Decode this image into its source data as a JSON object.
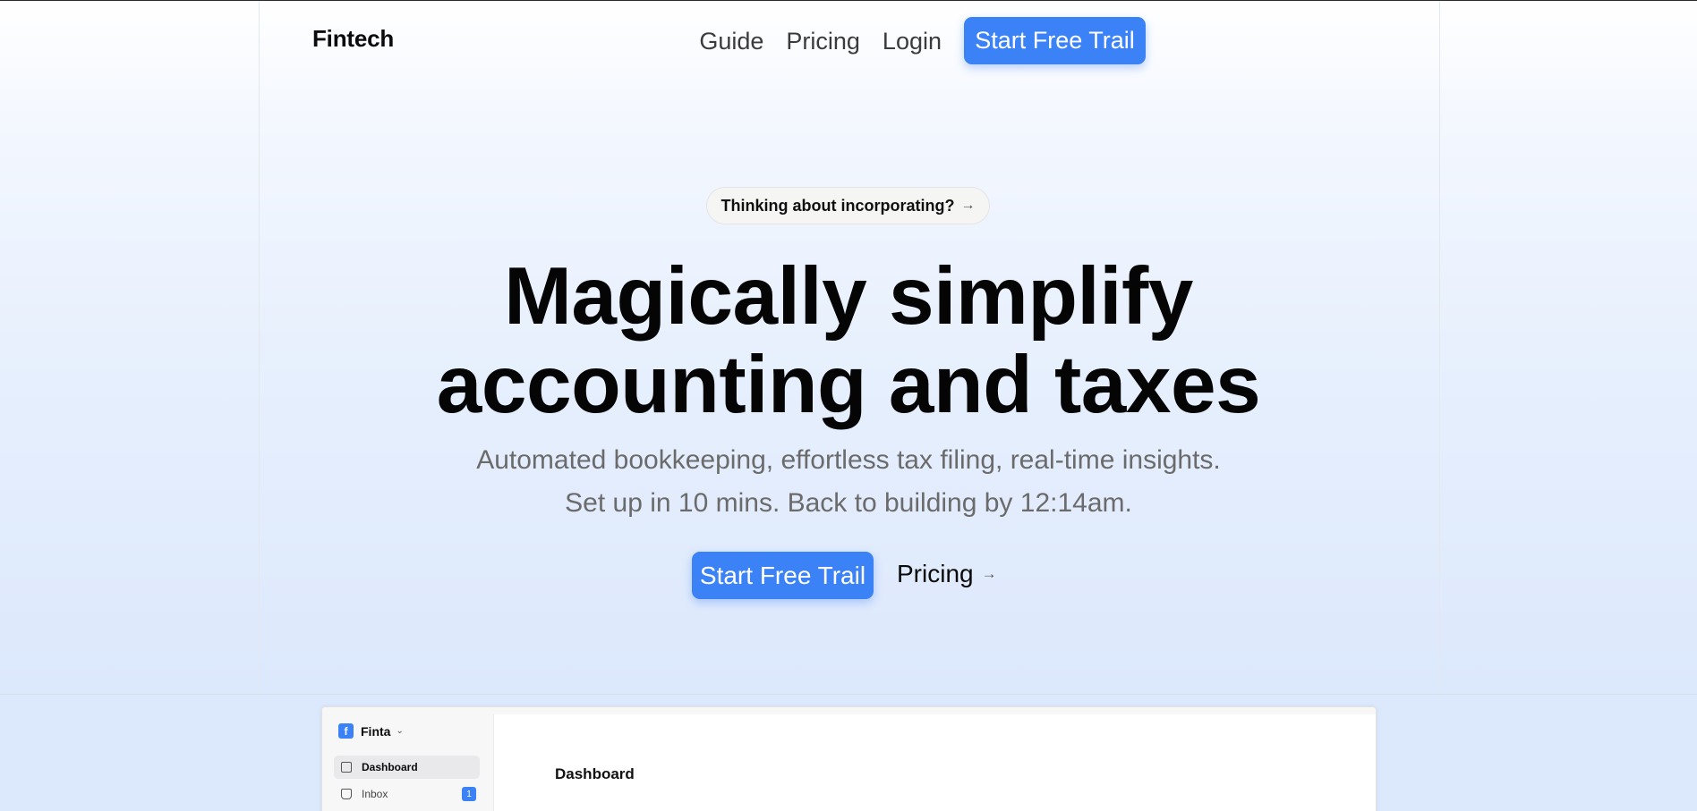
{
  "brand": {
    "name": "Fintech"
  },
  "nav": {
    "links": [
      "Guide",
      "Pricing",
      "Login"
    ],
    "cta_label": "Start Free Trail"
  },
  "announcement": {
    "label": "Thinking about incorporating?",
    "arrow": "→"
  },
  "hero": {
    "headline_line1": "Magically simplify",
    "headline_line2": "accounting and taxes",
    "subtitle_line1": "Automated bookkeeping, effortless tax filing, real-time insights.",
    "subtitle_line2": "Set up in 10 mins. Back to building by 12:14am.",
    "cta_label": "Start Free Trail",
    "secondary_label": "Pricing",
    "secondary_arrow": "→"
  },
  "app_preview": {
    "workspace_logo": "f",
    "workspace_name": "Finta",
    "workspace_chevron": "⌄",
    "sidebar": [
      {
        "label": "Dashboard",
        "icon": "calendar-icon",
        "active": true
      },
      {
        "label": "Inbox",
        "icon": "inbox-icon",
        "badge": "1"
      }
    ],
    "main_title": "Dashboard"
  },
  "colors": {
    "accent": "#3b82f6",
    "text": "#0b0b0b",
    "muted": "#6b6b6b"
  }
}
